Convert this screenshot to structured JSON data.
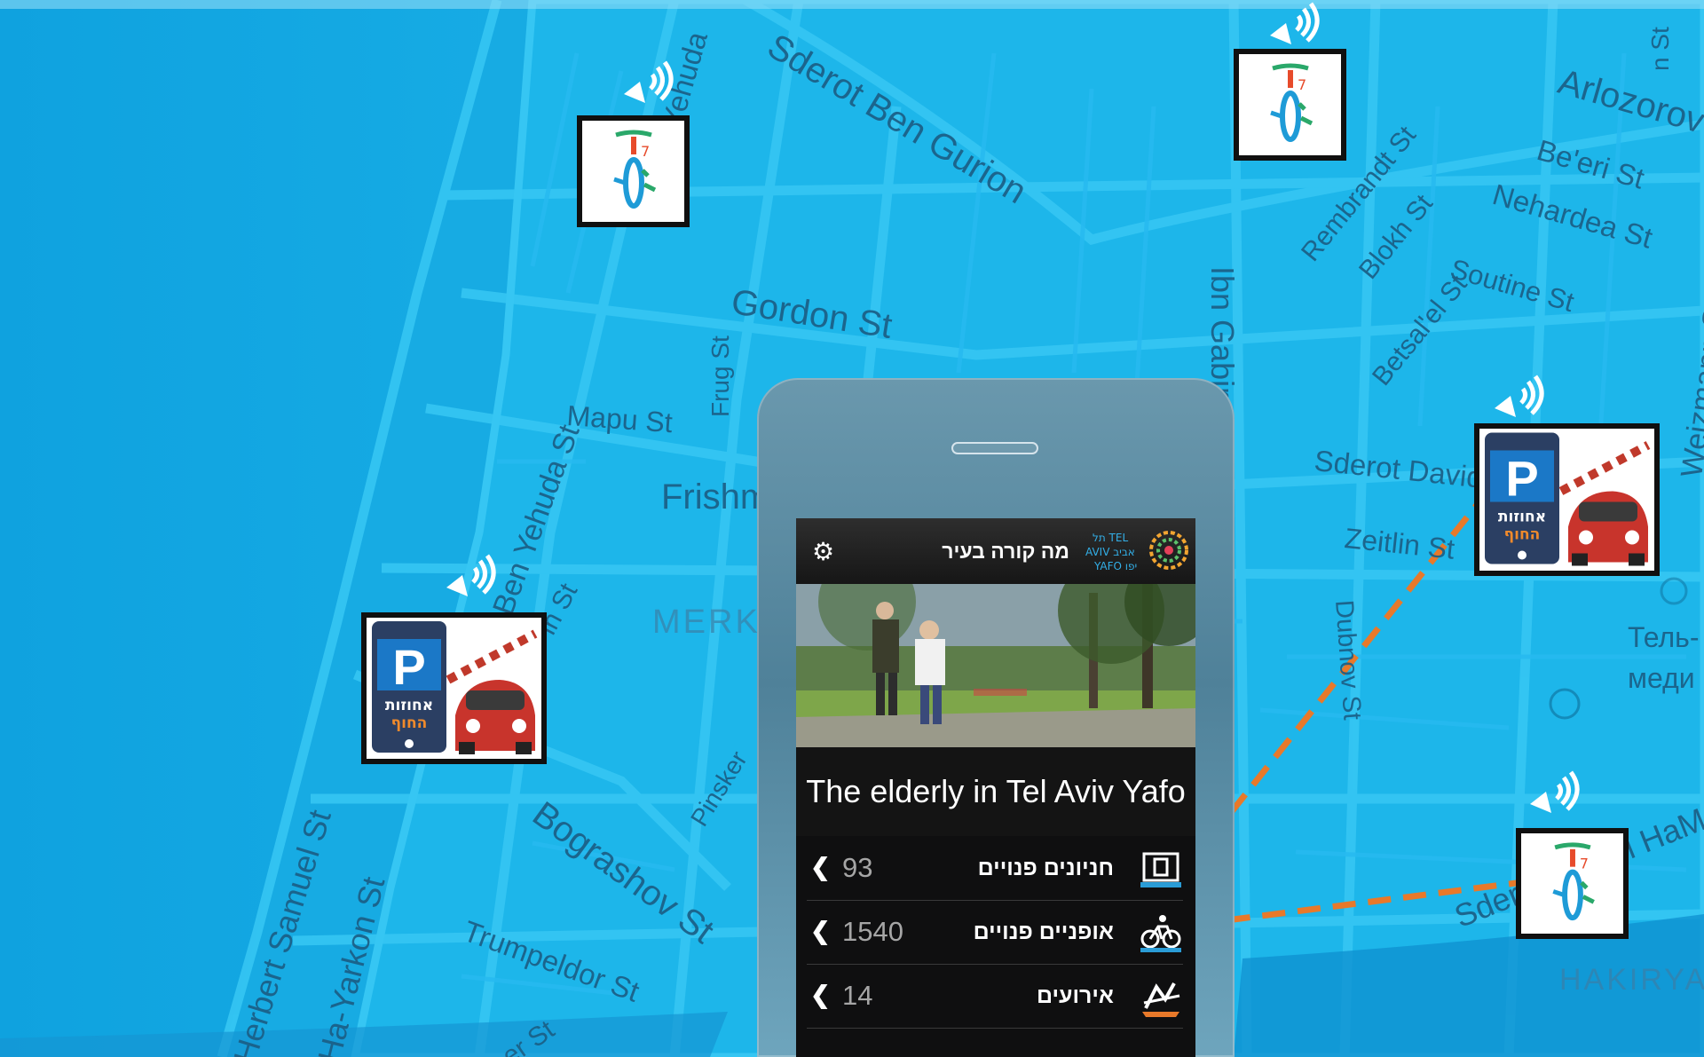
{
  "map": {
    "streets": [
      {
        "name": "Sderot Ben Gurion"
      },
      {
        "name": "Arlozorov"
      },
      {
        "name": "Be'eri St"
      },
      {
        "name": "Nehardea St"
      },
      {
        "name": "Rembrandt St"
      },
      {
        "name": "Blokh St"
      },
      {
        "name": "Betsal'el St"
      },
      {
        "name": "Soutine St"
      },
      {
        "name": "Gordon St"
      },
      {
        "name": "Frug St"
      },
      {
        "name": "Mapu St"
      },
      {
        "name": "Frishm"
      },
      {
        "name": "Ibn Gabirol St"
      },
      {
        "name": "Sderot David"
      },
      {
        "name": "Zeitlin St"
      },
      {
        "name": "Dubnov St"
      },
      {
        "name": "MERK"
      },
      {
        "name": "Pinsker"
      },
      {
        "name": "Bograshov St"
      },
      {
        "name": "Trumpeldor St"
      },
      {
        "name": "Herbert Samuel St"
      },
      {
        "name": "Ha-Yarkon St"
      },
      {
        "name": "Weizmann St"
      },
      {
        "name": "Тель-"
      },
      {
        "name": "меди"
      },
      {
        "name": "HAKIRYA"
      },
      {
        "name": "Sderot Sha'ul HaMelech"
      },
      {
        "name": "Yehuda"
      },
      {
        "name": "Ben Yehuda St"
      },
      {
        "name": "in St"
      },
      {
        "name": "er St"
      },
      {
        "name": "n St"
      }
    ],
    "markers": [
      {
        "kind": "bike-station"
      },
      {
        "kind": "bike-station"
      },
      {
        "kind": "parking-app"
      },
      {
        "kind": "parking-app"
      },
      {
        "kind": "bike-station"
      }
    ]
  },
  "phone_app": {
    "title": "מה קורה בעיר",
    "logo_text": {
      "line1": "תל TEL",
      "line2": "AVIV אביב",
      "line3": "YAFO יפו"
    },
    "headline": "The elderly in Tel Aviv Yafo",
    "rows": [
      {
        "label": "חניונים פנויים",
        "count": "93",
        "icon": "parking-icon"
      },
      {
        "label": "אופניים פנויים",
        "count": "1540",
        "icon": "bicycle-icon"
      },
      {
        "label": "אירועים",
        "count": "14",
        "icon": "events-icon"
      }
    ],
    "parking_brand": {
      "letter": "P",
      "line1": "אחוזות",
      "line2": "החוף"
    }
  },
  "colors": {
    "map_bg": "#16a9e2",
    "road": "#2fc3f2",
    "road_dark": "#0f93cf",
    "connector": "#e8792a"
  }
}
